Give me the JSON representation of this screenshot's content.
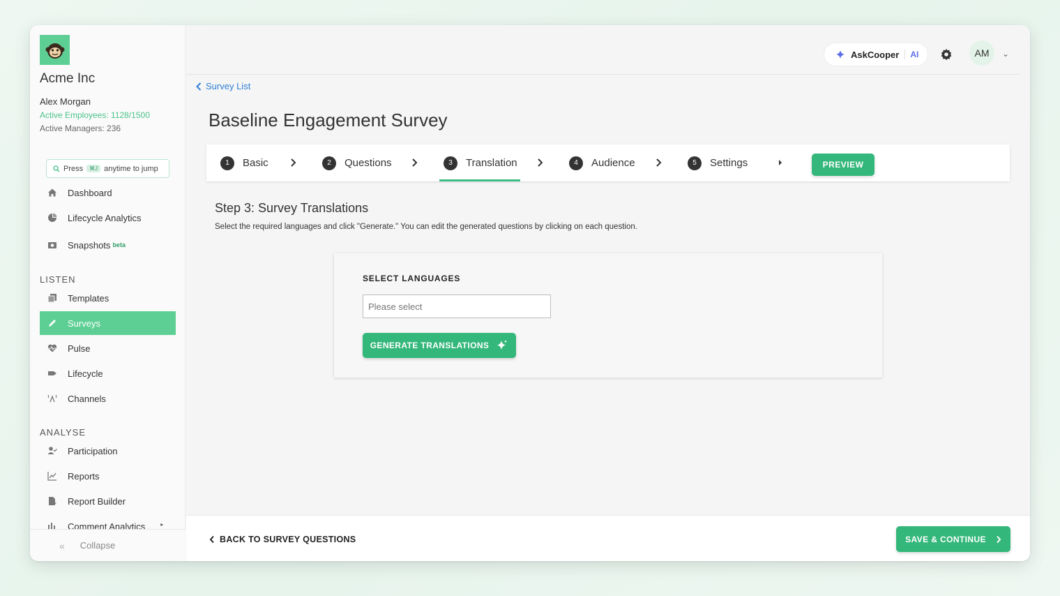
{
  "sidebar": {
    "company": "Acme Inc",
    "user_name": "Alex Morgan",
    "active_employees": "Active Employees: 1128/1500",
    "active_managers": "Active Managers: 236",
    "jump": {
      "press": "Press",
      "shortcut": "⌘J",
      "suffix": "anytime to jump"
    },
    "top_items": [
      {
        "label": "Dashboard",
        "icon": "home-icon"
      },
      {
        "label": "Lifecycle Analytics",
        "icon": "pie-chart-icon"
      },
      {
        "label": "Snapshots",
        "badge": "beta",
        "icon": "camera-icon"
      }
    ],
    "listen_header": "LISTEN",
    "listen_items": [
      {
        "label": "Templates",
        "icon": "templates-icon"
      },
      {
        "label": "Surveys",
        "icon": "pen-icon",
        "active": true
      },
      {
        "label": "Pulse",
        "icon": "heartbeat-icon"
      },
      {
        "label": "Lifecycle",
        "icon": "lifecycle-icon"
      },
      {
        "label": "Channels",
        "icon": "broadcast-icon"
      }
    ],
    "analyse_header": "ANALYSE",
    "analyse_items": [
      {
        "label": "Participation",
        "icon": "user-check-icon"
      },
      {
        "label": "Reports",
        "icon": "line-chart-icon"
      },
      {
        "label": "Report Builder",
        "icon": "report-builder-icon"
      },
      {
        "label": "Comment Analytics",
        "icon": "bar-chart-icon"
      }
    ],
    "collapse_label": "Collapse"
  },
  "topbar": {
    "askcooper_label": "AskCooper",
    "ai_label": "AI",
    "avatar_initials": "AM"
  },
  "breadcrumb": "Survey List",
  "page_title": "Baseline Engagement Survey",
  "steps": [
    {
      "num": "1",
      "label": "Basic"
    },
    {
      "num": "2",
      "label": "Questions"
    },
    {
      "num": "3",
      "label": "Translation",
      "active": true
    },
    {
      "num": "4",
      "label": "Audience"
    },
    {
      "num": "5",
      "label": "Settings"
    }
  ],
  "preview_label": "PREVIEW",
  "step_heading": "Step 3: Survey Translations",
  "step_description": "Select the required languages and click \"Generate.\" You can edit the generated questions by clicking on each question.",
  "languages": {
    "label": "SELECT LANGUAGES",
    "placeholder": "Please select",
    "value": ""
  },
  "generate_label": "GENERATE TRANSLATIONS",
  "footer": {
    "back_label": "BACK TO SURVEY QUESTIONS",
    "save_label": "SAVE & CONTINUE"
  },
  "colors": {
    "accent": "#34b77a",
    "sidebar_active": "#5ecf94",
    "link": "#2f7fd6"
  }
}
